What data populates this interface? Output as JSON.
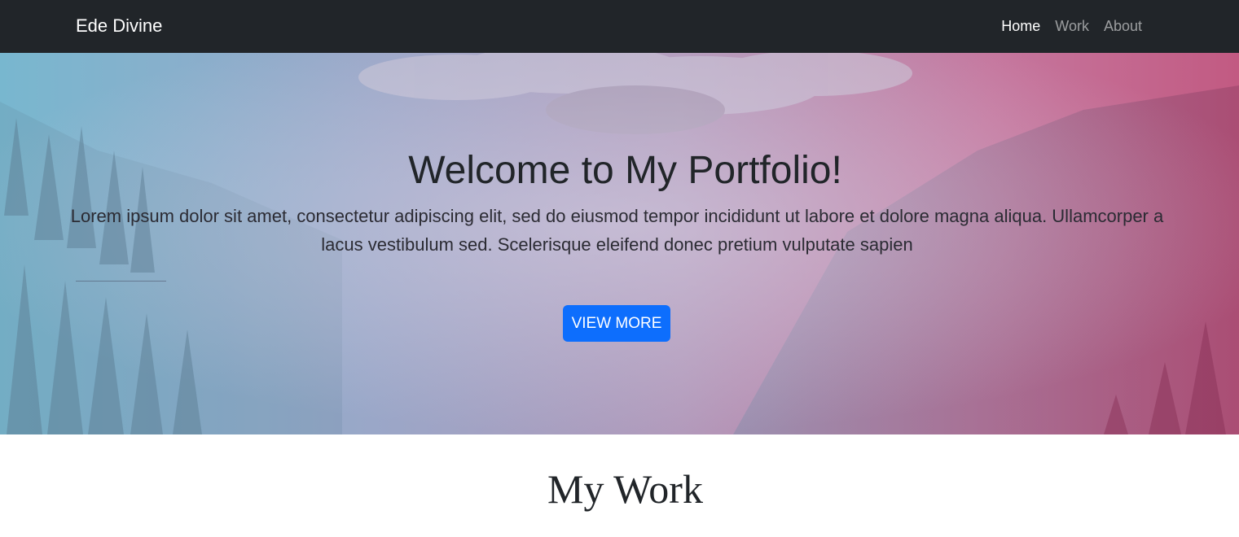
{
  "navbar": {
    "brand": "Ede Divine",
    "links": [
      {
        "label": "Home",
        "active": true
      },
      {
        "label": "Work",
        "active": false
      },
      {
        "label": "About",
        "active": false
      }
    ]
  },
  "hero": {
    "title": "Welcome to My Portfolio!",
    "lead": "Lorem ipsum dolor sit amet, consectetur adipiscing elit, sed do eiusmod tempor incididunt ut labore et dolore magna aliqua. Ullamcorper a lacus vestibulum sed. Scelerisque eleifend donec pretium vulputate sapien",
    "button_label": "VIEW MORE",
    "background_image": "misty-forest-mountains-clouds",
    "gradient_colors": [
      "#78b7cf",
      "#9aa7c8",
      "#b29abb",
      "#c5779e",
      "#c25a82"
    ]
  },
  "work_section": {
    "title": "My Work"
  },
  "colors": {
    "navbar_bg": "#212529",
    "button_primary": "#0d6efd",
    "text_dark": "#212529"
  }
}
